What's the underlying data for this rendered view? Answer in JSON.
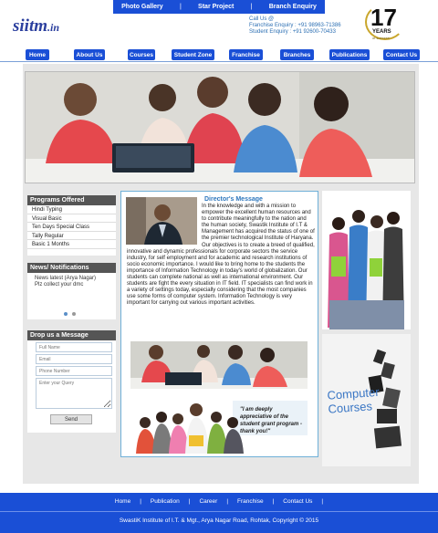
{
  "top_links": [
    {
      "label": "Photo Gallery"
    },
    {
      "label": "Star Project"
    },
    {
      "label": "Branch Enquiry"
    }
  ],
  "logo": {
    "main": "siitm",
    "suffix": ".in"
  },
  "contact": {
    "line1": "Call Us @",
    "line2": "Franchise Enquiry : +91 98963-71386",
    "line3": "Student Enquiry : +91 92600-70433"
  },
  "badge": {
    "number": "17",
    "word": "YEARS",
    "sub": "of success"
  },
  "nav": [
    {
      "label": "Home"
    },
    {
      "label": "About Us"
    },
    {
      "label": "Courses"
    },
    {
      "label": "Student Zone"
    },
    {
      "label": "Franchise"
    },
    {
      "label": "Branches"
    },
    {
      "label": "Publications"
    },
    {
      "label": "Contact Us"
    }
  ],
  "programs": {
    "title": "Programs Offered",
    "items": [
      "Hindi Typing",
      "Visual Basic",
      "Ten Days Special Class",
      "Tally Regular",
      "Basic 1 Months"
    ]
  },
  "news": {
    "title": "News/ Notifications",
    "item_title": "News latest (Arya Nagar)",
    "item_text": "Plz collect your dmc"
  },
  "message_form": {
    "title": "Drop us a Message",
    "name_placeholder": "Full Name",
    "email_placeholder": "Email",
    "phone_placeholder": "Phone Number",
    "query_placeholder": "Enter your Query",
    "send_label": "Send"
  },
  "director": {
    "title": "Director's Message",
    "text": "In the knowledge and with a mission to empower the excellent human resources and to contribute meaningfully to the nation and the human society, Swastik Institute of I.T & Management has acquired the status of one of the premier technological Institute of Haryana. Our objectives is to create a breed of qualified, innovative and dynamic professionals for corporate sectors the service industry, for self employment and for academic and research institutions of socio economic importance. I would like to bring home to the students the importance of Information Technology in today's world of globalization. Our students can complete national as well as international environment. Our students are fight the every situation in IT field. IT specialists can find work in a variety of settings today, especially considering that the most companies use some forms of computer system. Information Technology is very important for carrying out various important activities."
  },
  "testimonial": {
    "quote": "\"I am deeply appreciative of the student grant program - thank you!\""
  },
  "promo": {
    "text": "Computer Courses"
  },
  "footer": {
    "links": [
      {
        "label": "Home"
      },
      {
        "label": "Publication"
      },
      {
        "label": "Career"
      },
      {
        "label": "Franchise"
      },
      {
        "label": "Contact Us"
      }
    ],
    "copyright": "SwastiK Institute of I.T. & Mgt., Arya Nagar Road, Rohtak, Copyright © 2015"
  },
  "colors": {
    "brand_blue": "#1a4fd6",
    "accent": "#2e77bd",
    "panel_dark": "#555555"
  }
}
